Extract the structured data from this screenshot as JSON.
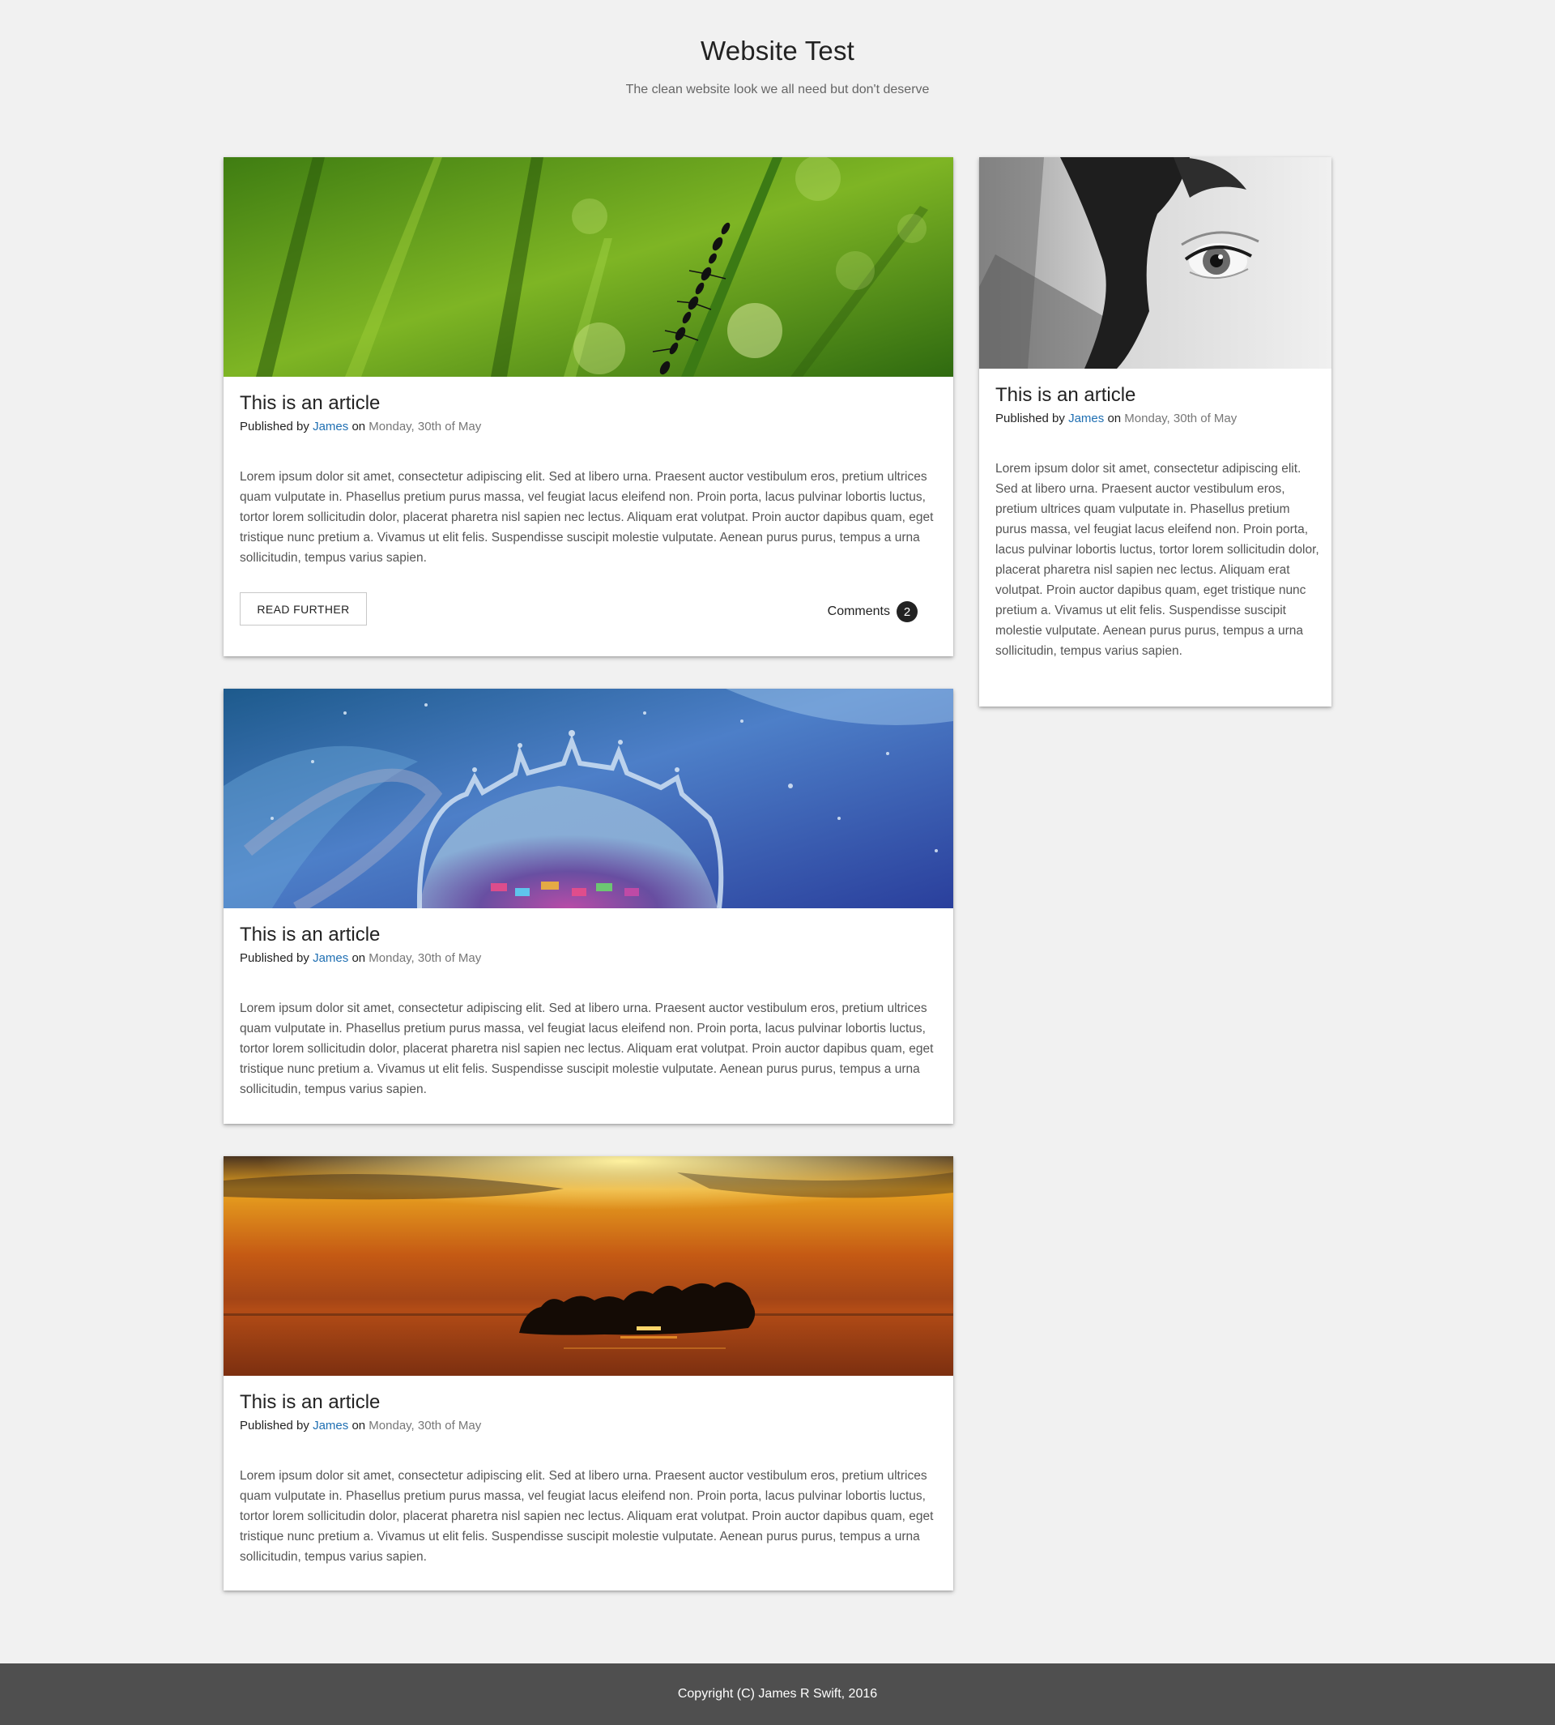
{
  "header": {
    "title": "Website Test",
    "tagline": "The clean website look we all need but don't deserve"
  },
  "articles": [
    {
      "image": "green grass blades with ants climbing",
      "title": "This is an article",
      "published_prefix": "Published by",
      "author": "James",
      "on_label": "on",
      "date": "Monday, 30th of May",
      "body": "Lorem ipsum dolor sit amet, consectetur adipiscing elit. Sed at libero urna. Praesent auctor vestibulum eros, pretium ultrices quam vulputate in. Phasellus pretium purus massa, vel feugiat lacus eleifend non. Proin porta, lacus pulvinar lobortis luctus, tortor lorem sollicitudin dolor, placerat pharetra nisl sapien nec lectus. Aliquam erat volutpat. Proin auctor dapibus quam, eget tristique nunc pretium a. Vivamus ut elit felis. Suspendisse suscipit molestie vulputate. Aenean purus purus, tempus a urna sollicitudin, tempus varius sapien.",
      "read_further_label": "READ FURTHER",
      "comments_label": "Comments",
      "comments_count": "2"
    },
    {
      "image": "blue water droplet splash crown",
      "title": "This is an article",
      "published_prefix": "Published by",
      "author": "James",
      "on_label": "on",
      "date": "Monday, 30th of May",
      "body": "Lorem ipsum dolor sit amet, consectetur adipiscing elit. Sed at libero urna. Praesent auctor vestibulum eros, pretium ultrices quam vulputate in. Phasellus pretium purus massa, vel feugiat lacus eleifend non. Proin porta, lacus pulvinar lobortis luctus, tortor lorem sollicitudin dolor, placerat pharetra nisl sapien nec lectus. Aliquam erat volutpat. Proin auctor dapibus quam, eget tristique nunc pretium a. Vivamus ut elit felis. Suspendisse suscipit molestie vulputate. Aenean purus purus, tempus a urna sollicitudin, tempus varius sapien."
    },
    {
      "image": "orange sunset over lake with tree island silhouette",
      "title": "This is an article",
      "published_prefix": "Published by",
      "author": "James",
      "on_label": "on",
      "date": "Monday, 30th of May",
      "body": "Lorem ipsum dolor sit amet, consectetur adipiscing elit. Sed at libero urna. Praesent auctor vestibulum eros, pretium ultrices quam vulputate in. Phasellus pretium purus massa, vel feugiat lacus eleifend non. Proin porta, lacus pulvinar lobortis luctus, tortor lorem sollicitudin dolor, placerat pharetra nisl sapien nec lectus. Aliquam erat volutpat. Proin auctor dapibus quam, eget tristique nunc pretium a. Vivamus ut elit felis. Suspendisse suscipit molestie vulputate. Aenean purus purus, tempus a urna sollicitudin, tempus varius sapien."
    }
  ],
  "sidebar_article": {
    "image": "black and white close-up of a woman's eye",
    "title": "This is an article",
    "published_prefix": "Published by",
    "author": "James",
    "on_label": "on",
    "date": "Monday, 30th of May",
    "body": "Lorem ipsum dolor sit amet, consectetur adipiscing elit. Sed at libero urna. Praesent auctor vestibulum eros, pretium ultrices quam vulputate in. Phasellus pretium purus massa, vel feugiat lacus eleifend non. Proin porta, lacus pulvinar lobortis luctus, tortor lorem sollicitudin dolor, placerat pharetra nisl sapien nec lectus. Aliquam erat volutpat. Proin auctor dapibus quam, eget tristique nunc pretium a. Vivamus ut elit felis. Suspendisse suscipit molestie vulputate. Aenean purus purus, tempus a urna sollicitudin, tempus varius sapien."
  },
  "footer": {
    "copyright": "Copyright (C) James R Swift, 2016"
  },
  "colors": {
    "background": "#f1f1f1",
    "link": "#1f6fb2",
    "footer": "#4f4f4f"
  }
}
